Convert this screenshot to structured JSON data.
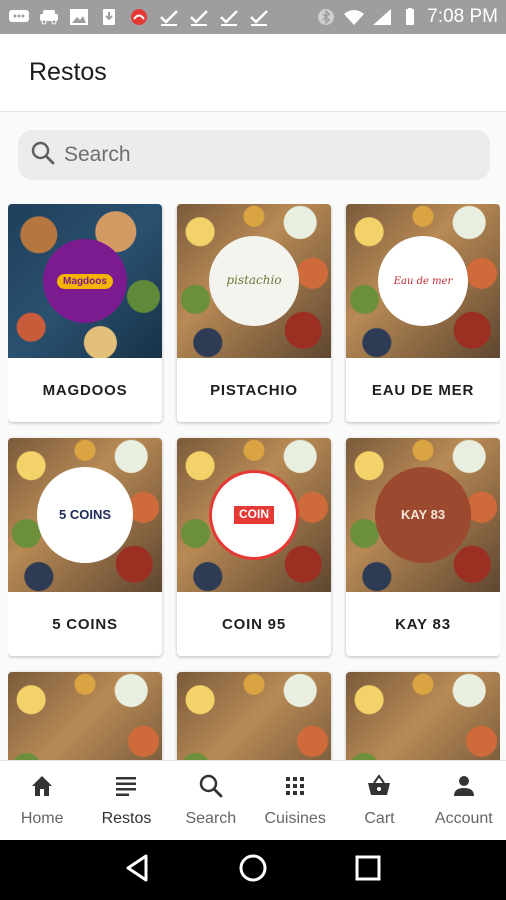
{
  "status_bar": {
    "time": "7:08 PM",
    "left_icons": [
      "chat-icon",
      "car-icon",
      "image-icon",
      "download-icon",
      "missed-call-icon",
      "check-icon",
      "check-icon",
      "check-icon",
      "check-icon"
    ],
    "right_icons": [
      "bluetooth-icon",
      "wifi-icon",
      "signal-icon",
      "battery-icon"
    ]
  },
  "appbar": {
    "title": "Restos"
  },
  "search": {
    "placeholder": "Search"
  },
  "restaurants": [
    {
      "name": "MAGDOOS",
      "logo_text": "Magdoos",
      "logo_bg": "#7b1b8f",
      "logo_fg": "#f5b400"
    },
    {
      "name": "PISTACHIO",
      "logo_text": "pistachio",
      "logo_bg": "#f4f4ee",
      "logo_fg": "#6b7a3a"
    },
    {
      "name": "EAU DE MER",
      "logo_text": "Eau de mer",
      "logo_bg": "#ffffff",
      "logo_fg": "#c0262d"
    },
    {
      "name": "5 COINS",
      "logo_text": "5 COINS",
      "logo_bg": "#ffffff",
      "logo_fg": "#1e2a57"
    },
    {
      "name": "COIN 95",
      "logo_text": "COIN",
      "logo_bg": "#ffffff",
      "logo_fg": "#e53935"
    },
    {
      "name": "KAY 83",
      "logo_text": "KAY 83",
      "logo_bg": "#9c4a2f",
      "logo_fg": "#f3e6d6"
    },
    {
      "name": "",
      "logo_text": "",
      "logo_bg": "#2b2b2b",
      "logo_fg": "#ffffff"
    },
    {
      "name": "",
      "logo_text": "",
      "logo_bg": "#8bc34a",
      "logo_fg": "#ffffff"
    },
    {
      "name": "",
      "logo_text": "",
      "logo_bg": "#c98b78",
      "logo_fg": "#ffffff"
    }
  ],
  "bottom_nav": [
    {
      "label": "Home",
      "icon": "home-icon"
    },
    {
      "label": "Restos",
      "icon": "list-icon",
      "active": true
    },
    {
      "label": "Search",
      "icon": "search-icon"
    },
    {
      "label": "Cuisines",
      "icon": "grid-icon"
    },
    {
      "label": "Cart",
      "icon": "basket-icon"
    },
    {
      "label": "Account",
      "icon": "person-icon"
    }
  ],
  "system_nav": [
    "back-icon",
    "home-circle-icon",
    "recents-icon"
  ]
}
